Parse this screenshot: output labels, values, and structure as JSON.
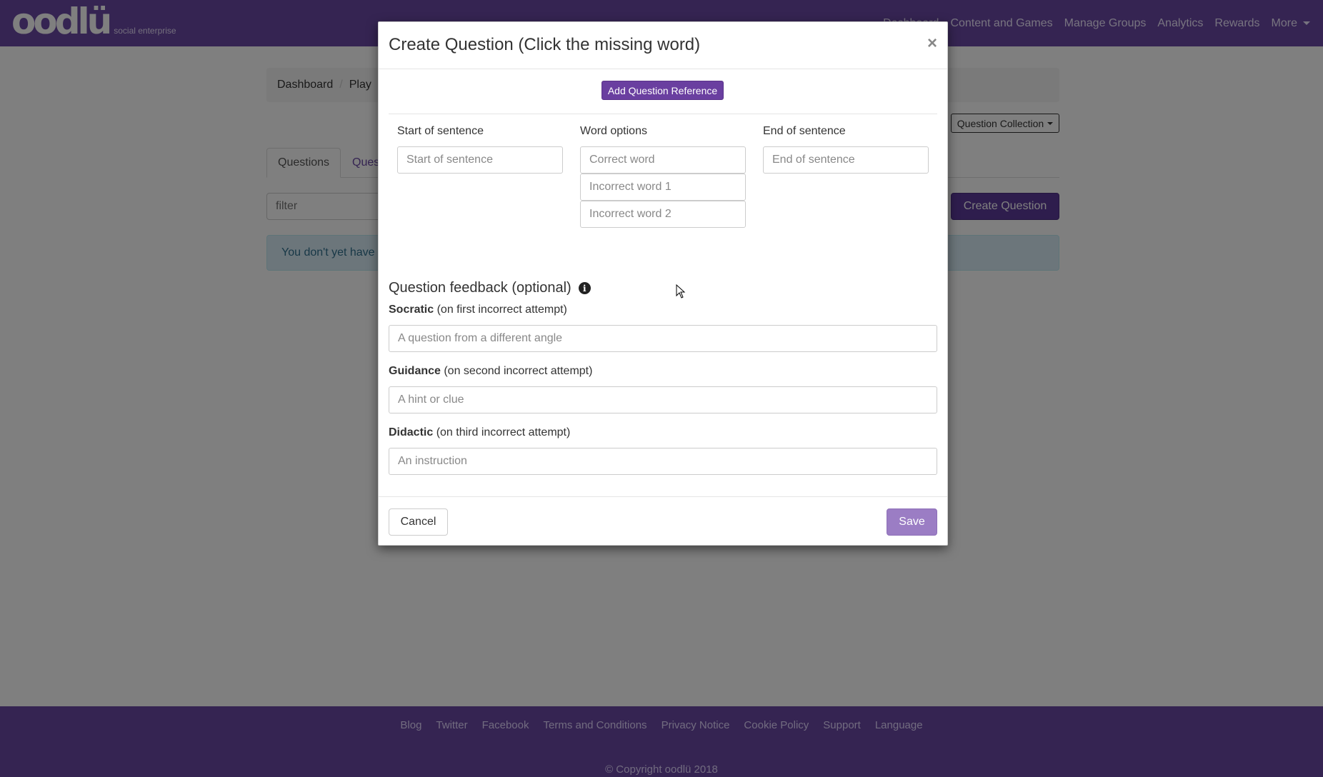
{
  "navbar": {
    "logo": "oodlü",
    "logo_sub": "social enterprise",
    "links": [
      "Dashboard",
      "Content and Games",
      "Manage Groups",
      "Analytics",
      "Rewards"
    ],
    "more_label": "More"
  },
  "breadcrumb": {
    "items": [
      "Dashboard",
      "Play"
    ]
  },
  "page": {
    "collection_dropdown": "Question Collection",
    "tabs": [
      "Questions",
      "Question Collections"
    ],
    "filter_placeholder": "filter",
    "create_button": "Create Question",
    "empty_alert": "You don't yet have any questions"
  },
  "modal": {
    "title": "Create Question (Click the missing word)",
    "close_symbol": "×",
    "add_reference_button": "Add Question Reference",
    "columns": {
      "start_label": "Start of sentence",
      "start_placeholder": "Start of sentence",
      "options_label": "Word options",
      "correct_placeholder": "Correct word",
      "incorrect1_placeholder": "Incorrect word 1",
      "incorrect2_placeholder": "Incorrect word 2",
      "end_label": "End of sentence",
      "end_placeholder": "End of sentence"
    },
    "feedback": {
      "heading": "Question feedback (optional)",
      "socratic_bold": "Socratic",
      "socratic_note": " (on first incorrect attempt)",
      "socratic_placeholder": "A question from a different angle",
      "guidance_bold": "Guidance",
      "guidance_note": " (on second incorrect attempt)",
      "guidance_placeholder": "A hint or clue",
      "didactic_bold": "Didactic",
      "didactic_note": " (on third incorrect attempt)",
      "didactic_placeholder": "An instruction"
    },
    "cancel_button": "Cancel",
    "save_button": "Save"
  },
  "footer": {
    "links": [
      "Blog",
      "Twitter",
      "Facebook",
      "Terms and Conditions",
      "Privacy Notice",
      "Cookie Policy",
      "Support",
      "Language"
    ],
    "copyright": "© Copyright oodlü 2018"
  },
  "colors": {
    "brand_purple": "#6a48a4",
    "button_purple": "#6a3fa0",
    "save_disabled": "#9b7dc4"
  }
}
